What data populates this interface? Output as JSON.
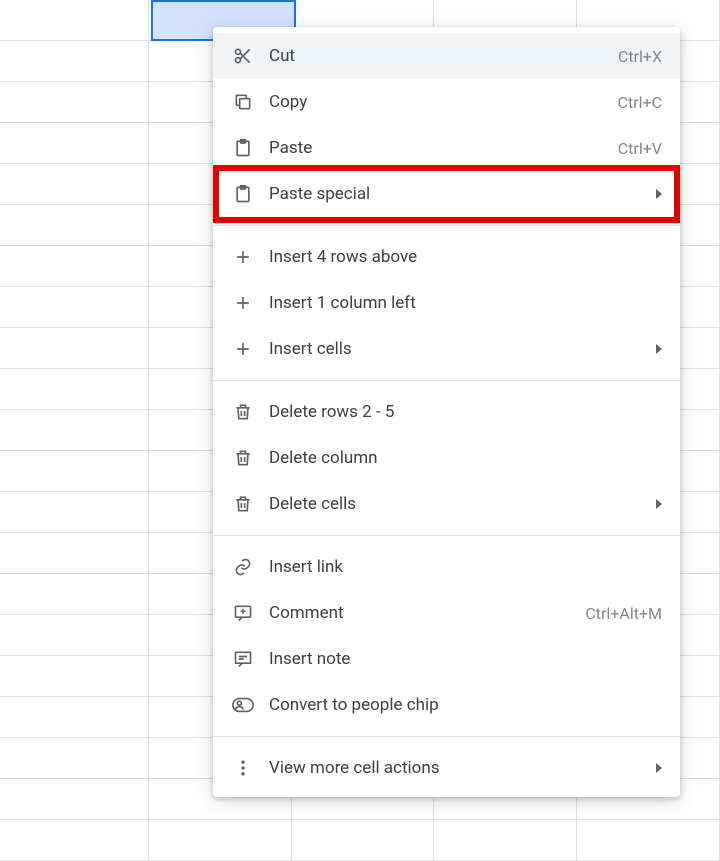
{
  "selection": {
    "range": "B1",
    "note": "selected cell shown blue"
  },
  "contextMenu": {
    "groups": [
      [
        {
          "id": "cut",
          "label": "Cut",
          "shortcut": "Ctrl+X",
          "icon": "cut",
          "hover": true
        },
        {
          "id": "copy",
          "label": "Copy",
          "shortcut": "Ctrl+C",
          "icon": "copy"
        },
        {
          "id": "paste",
          "label": "Paste",
          "shortcut": "Ctrl+V",
          "icon": "paste"
        },
        {
          "id": "paste_special",
          "label": "Paste special",
          "icon": "paste",
          "submenu": true,
          "highlight": true
        }
      ],
      [
        {
          "id": "insert_rows_above",
          "label": "Insert 4 rows above",
          "icon": "plus"
        },
        {
          "id": "insert_col_left",
          "label": "Insert 1 column left",
          "icon": "plus"
        },
        {
          "id": "insert_cells",
          "label": "Insert cells",
          "icon": "plus",
          "submenu": true
        }
      ],
      [
        {
          "id": "delete_rows",
          "label": "Delete rows 2 - 5",
          "icon": "trash"
        },
        {
          "id": "delete_column",
          "label": "Delete column",
          "icon": "trash"
        },
        {
          "id": "delete_cells",
          "label": "Delete cells",
          "icon": "trash",
          "submenu": true
        }
      ],
      [
        {
          "id": "insert_link",
          "label": "Insert link",
          "icon": "link"
        },
        {
          "id": "comment",
          "label": "Comment",
          "shortcut": "Ctrl+Alt+M",
          "icon": "comment"
        },
        {
          "id": "insert_note",
          "label": "Insert note",
          "icon": "note"
        },
        {
          "id": "people_chip",
          "label": "Convert to people chip",
          "icon": "person"
        }
      ],
      [
        {
          "id": "more",
          "label": "View more cell actions",
          "icon": "more",
          "submenu": true
        }
      ]
    ]
  }
}
